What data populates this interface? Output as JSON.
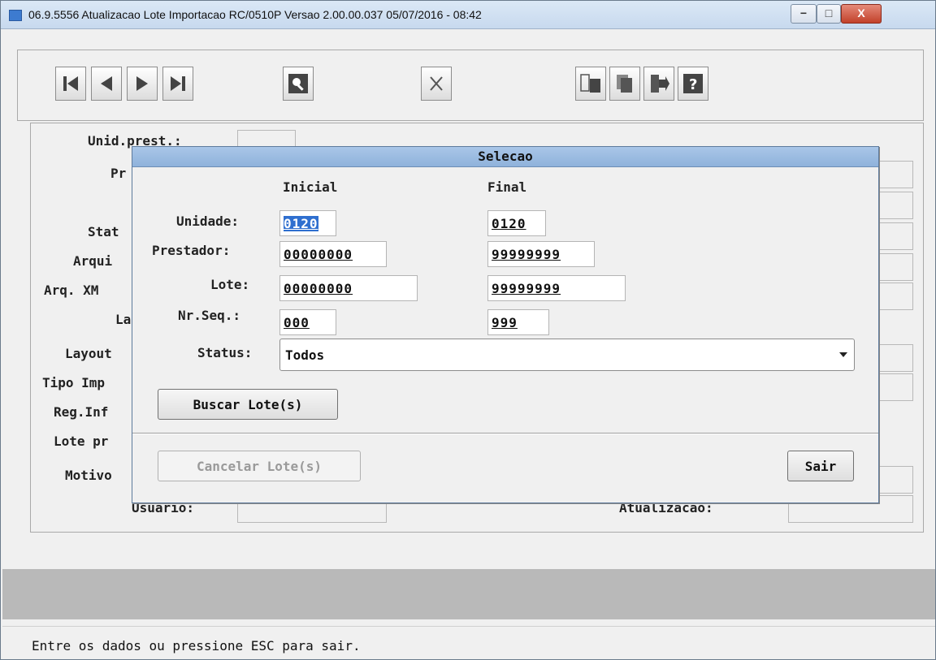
{
  "window": {
    "title": "06.9.5556 Atualizacao  Lote Importacao RC/0510P Versao 2.00.00.037 05/07/2016 - 08:42",
    "controls": {
      "minimize": "−",
      "maximize": "□",
      "close": "X"
    }
  },
  "toolbar": {
    "icons": [
      "first-record-icon",
      "previous-record-icon",
      "next-record-icon",
      "last-record-icon",
      "search-icon",
      "cancel-icon",
      "filter-icon",
      "copy-icon",
      "exit-icon",
      "help-icon"
    ]
  },
  "form": {
    "labels": {
      "unid_prest": "Unid.prest.:",
      "prestador_partial": "Pr",
      "status_partial": "Stat",
      "arquivo_partial": "Arqui",
      "arq_xml_partial": "Arq. XM",
      "layout1_partial": "La",
      "layout2_partial": "Layout",
      "tipo_imp_partial": "Tipo Imp",
      "reg_inf_partial": "Reg.Inf",
      "lote_pr_partial": "Lote pr",
      "motivo_partial": "Motivo",
      "usuario": "Usuario:",
      "atualizacao": "Atualizacao:"
    }
  },
  "dialog": {
    "title": "Selecao",
    "col_initial": "Inicial",
    "col_final": "Final",
    "fields": {
      "unidade": {
        "label": "Unidade:",
        "initial": "0120",
        "final": "0120"
      },
      "prestador": {
        "label": "Prestador:",
        "initial": "00000000",
        "final": "99999999"
      },
      "lote": {
        "label": "Lote:",
        "initial": "00000000",
        "final": "99999999"
      },
      "nr_seq": {
        "label": "Nr.Seq.:",
        "initial": "000",
        "final": "999"
      }
    },
    "status": {
      "label": "Status:",
      "value": "Todos"
    },
    "buttons": {
      "buscar": "Buscar Lote(s)",
      "cancelar": "Cancelar Lote(s)",
      "sair": "Sair"
    }
  },
  "message": "Entre os dados ou pressione ESC para sair."
}
